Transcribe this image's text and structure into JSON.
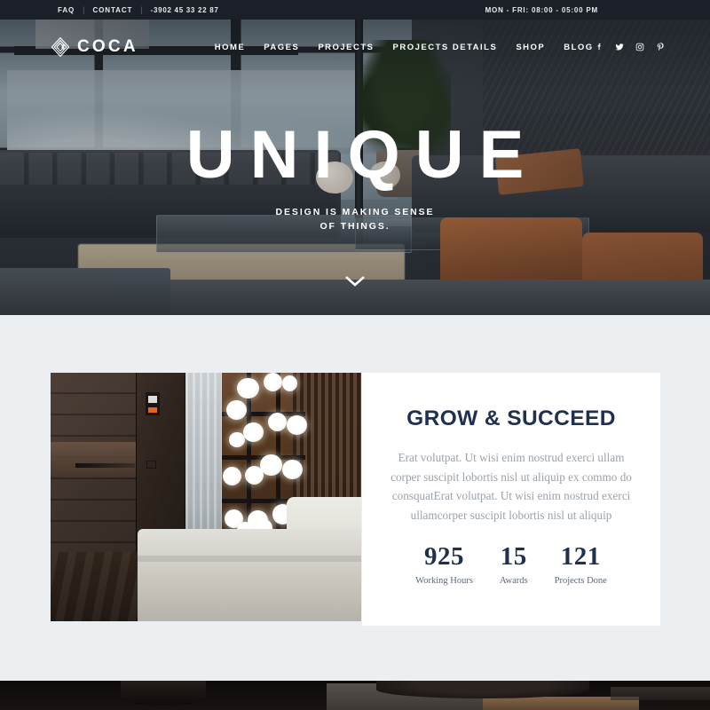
{
  "topbar": {
    "links": [
      {
        "label": "FAQ"
      },
      {
        "label": "CONTACT"
      }
    ],
    "separator": "|",
    "phone": "-3902 45 33 22 87",
    "hours": "MON - FRI: 08:00 - 05:00 PM"
  },
  "header": {
    "logo_text": "COCA",
    "logo_icon": "diamond-hexagon-logo-icon",
    "nav": [
      {
        "label": "HOME"
      },
      {
        "label": "PAGES"
      },
      {
        "label": "PROJECTS"
      },
      {
        "label": "PROJECTS DETAILS"
      },
      {
        "label": "SHOP"
      },
      {
        "label": "BLOG"
      }
    ],
    "social": [
      {
        "name": "facebook-icon"
      },
      {
        "name": "twitter-icon"
      },
      {
        "name": "instagram-icon"
      },
      {
        "name": "pinterest-icon"
      }
    ]
  },
  "hero": {
    "title": "UNIQUE",
    "subtitle_line1": "DESIGN IS MAKING SENSE",
    "subtitle_line2": "OF THINGS.",
    "scroll_icon": "chevron-down-icon",
    "photo_alt": "modern-living-room-interior"
  },
  "about": {
    "photo_alt": "dark-interior-with-bubble-lights-and-daybed",
    "title": "GROW & SUCCEED",
    "paragraph": "Erat volutpat. Ut wisi enim nostrud exerci ullam corper suscipit lobortis nisl ut aliquip ex commo do consquatErat volutpat. Ut wisi enim nostrud exerci ullamcorper suscipit lobortis nisl ut aliquip",
    "stats": [
      {
        "value": "925",
        "label": "Working Hours"
      },
      {
        "value": "15",
        "label": "Awards"
      },
      {
        "value": "121",
        "label": "Projects Done"
      }
    ]
  },
  "bottom": {
    "photo_alt": "dark-interior-detail"
  },
  "colors": {
    "topbar_bg": "#1b2028",
    "section_bg": "#eceff1",
    "card_bg": "#ffffff",
    "heading_navy": "#20304f",
    "body_text": "#9aa3ad",
    "accent_orange": "#e8631c"
  }
}
